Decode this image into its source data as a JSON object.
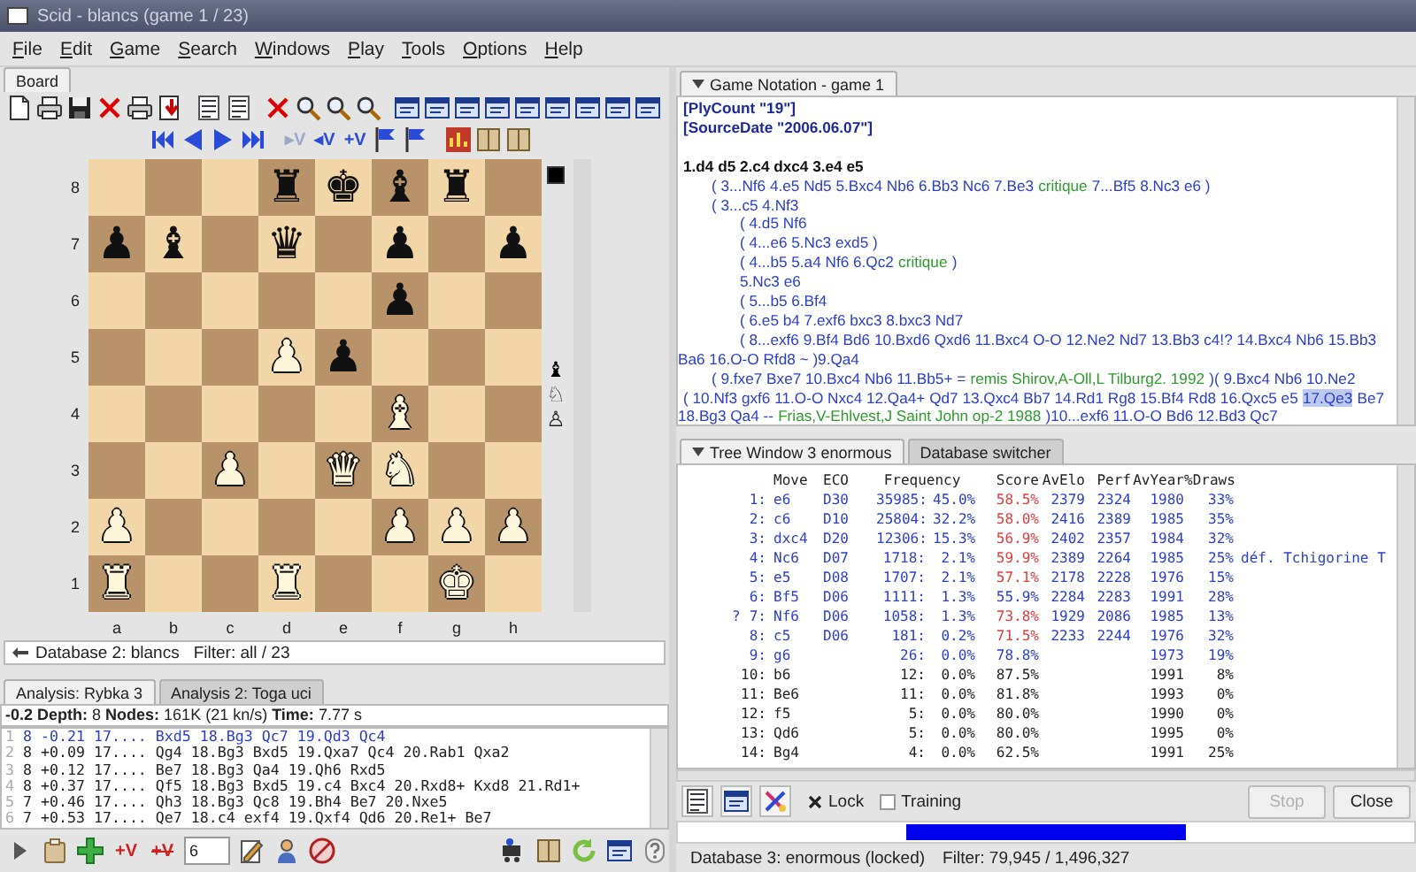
{
  "window": {
    "title": "Scid - blancs (game 1 / 23)"
  },
  "menu": [
    "File",
    "Edit",
    "Game",
    "Search",
    "Windows",
    "Play",
    "Tools",
    "Options",
    "Help"
  ],
  "board_panel": {
    "tab": "Board",
    "variation_buttons": [
      {
        "text": "▸V",
        "disabled": true
      },
      {
        "text": "◂V",
        "disabled": false
      },
      {
        "text": "+V",
        "disabled": false
      }
    ],
    "board": {
      "files": [
        "a",
        "b",
        "c",
        "d",
        "e",
        "f",
        "g",
        "h"
      ],
      "black_to_move": true,
      "material": [
        {
          "piece": "♝",
          "white": false
        },
        {
          "piece": "♘",
          "white": true
        },
        {
          "piece": "♙",
          "white": true
        }
      ],
      "ranks": [
        {
          "label": "8",
          "squares": [
            {
              "kind": "empty"
            },
            {
              "kind": "empty"
            },
            {
              "kind": "empty"
            },
            {
              "kind": "piece",
              "piece": "♜",
              "white": false
            },
            {
              "kind": "piece",
              "piece": "♚",
              "white": false
            },
            {
              "kind": "piece",
              "piece": "♝",
              "white": false
            },
            {
              "kind": "piece",
              "piece": "♜",
              "white": false
            },
            {
              "kind": "empty"
            }
          ]
        },
        {
          "label": "7",
          "squares": [
            {
              "kind": "piece",
              "piece": "♟",
              "white": false
            },
            {
              "kind": "piece",
              "piece": "♝",
              "white": false
            },
            {
              "kind": "empty"
            },
            {
              "kind": "piece",
              "piece": "♛",
              "white": false
            },
            {
              "kind": "empty"
            },
            {
              "kind": "piece",
              "piece": "♟",
              "white": false
            },
            {
              "kind": "empty"
            },
            {
              "kind": "piece",
              "piece": "♟",
              "white": false
            }
          ]
        },
        {
          "label": "6",
          "squares": [
            {
              "kind": "empty"
            },
            {
              "kind": "empty"
            },
            {
              "kind": "empty"
            },
            {
              "kind": "empty"
            },
            {
              "kind": "empty"
            },
            {
              "kind": "piece",
              "piece": "♟",
              "white": false
            },
            {
              "kind": "empty"
            },
            {
              "kind": "empty"
            }
          ]
        },
        {
          "label": "5",
          "squares": [
            {
              "kind": "empty"
            },
            {
              "kind": "empty"
            },
            {
              "kind": "empty"
            },
            {
              "kind": "piece",
              "piece": "♟",
              "white": true
            },
            {
              "kind": "piece",
              "piece": "♟",
              "white": false
            },
            {
              "kind": "empty"
            },
            {
              "kind": "empty"
            },
            {
              "kind": "empty"
            }
          ]
        },
        {
          "label": "4",
          "squares": [
            {
              "kind": "empty"
            },
            {
              "kind": "empty"
            },
            {
              "kind": "empty"
            },
            {
              "kind": "empty"
            },
            {
              "kind": "empty"
            },
            {
              "kind": "piece",
              "piece": "♝",
              "white": true
            },
            {
              "kind": "empty"
            },
            {
              "kind": "empty"
            }
          ]
        },
        {
          "label": "3",
          "squares": [
            {
              "kind": "empty"
            },
            {
              "kind": "empty"
            },
            {
              "kind": "piece",
              "piece": "♟",
              "white": true
            },
            {
              "kind": "empty"
            },
            {
              "kind": "piece",
              "piece": "♛",
              "white": true
            },
            {
              "kind": "piece",
              "piece": "♞",
              "white": true
            },
            {
              "kind": "empty"
            },
            {
              "kind": "empty"
            }
          ]
        },
        {
          "label": "2",
          "squares": [
            {
              "kind": "piece",
              "piece": "♟",
              "white": true
            },
            {
              "kind": "empty"
            },
            {
              "kind": "empty"
            },
            {
              "kind": "empty"
            },
            {
              "kind": "empty"
            },
            {
              "kind": "piece",
              "piece": "♟",
              "white": true
            },
            {
              "kind": "piece",
              "piece": "♟",
              "white": true
            },
            {
              "kind": "piece",
              "piece": "♟",
              "white": true
            }
          ]
        },
        {
          "label": "1",
          "squares": [
            {
              "kind": "piece",
              "piece": "♜",
              "white": true
            },
            {
              "kind": "empty"
            },
            {
              "kind": "empty"
            },
            {
              "kind": "piece",
              "piece": "♜",
              "white": true
            },
            {
              "kind": "empty"
            },
            {
              "kind": "empty"
            },
            {
              "kind": "piece",
              "piece": "♚",
              "white": true
            },
            {
              "kind": "empty"
            }
          ]
        }
      ]
    },
    "status": {
      "database": "Database 2: blancs",
      "filter": "Filter: all / 23"
    }
  },
  "analysis": {
    "tabs": [
      {
        "label": "Analysis: Rybka 3",
        "selected": true
      },
      {
        "label": "Analysis 2: Toga uci",
        "selected": false
      }
    ],
    "info": "**-0.2 Depth:** 8 **Nodes:** 161K (21 kn/s) **Time:** 7.77 s",
    "lines": [
      {
        "number": "1",
        "text": "8 -0.21 17.... Bxd5 18.Bg3 Qc7 19.Qd3 Qc4",
        "highlighted": true
      },
      {
        "number": "2",
        "text": "8 +0.09 17.... Qg4 18.Bg3 Bxd5 19.Qxa7 Qc4 20.Rab1 Qxa2",
        "highlighted": false
      },
      {
        "number": "3",
        "text": "8 +0.12 17.... Be7 18.Bg3 Qa4 19.Qh6 Rxd5",
        "highlighted": false
      },
      {
        "number": "4",
        "text": "8 +0.37 17.... Qf5 18.Bg3 Bxd5 19.c4 Bxc4 20.Rxd8+ Kxd8 21.Rd1+",
        "highlighted": false
      },
      {
        "number": "5",
        "text": "7 +0.46 17.... Qh3 18.Bg3 Qc8 19.Bh4 Be7 20.Nxe5",
        "highlighted": false
      },
      {
        "number": "6",
        "text": "7 +0.53 17.... Qe7 18.c4 exf4 19.Qxf4 Qd6 20.Re1+ Be7",
        "highlighted": false
      }
    ],
    "toolbar": {
      "add_variation": "+V",
      "add_all_variations": "+V",
      "line_count": "6"
    }
  },
  "notation": {
    "tab": "Game Notation - game 1",
    "headers": [
      "[PlyCount \"19\"]",
      "[SourceDate \"2006.06.07\"]"
    ],
    "lines": [
      {
        "segments": [
          {
            "kind": "main",
            "text": "1.d4 d5 2.c4 dxc4 3.e4 e5"
          }
        ],
        "children": [
          {
            "segments": [
              {
                "kind": "move",
                "text": "( 3...Nf6 4.e5 Nd5 5.Bxc4 Nb6 6.Bb3 Nc6 7.Be3"
              },
              {
                "kind": "comment",
                "text": "critique"
              },
              {
                "kind": "move",
                "text": "7...Bf5 8.Nc3 e6 )"
              }
            ]
          },
          {
            "segments": [
              {
                "kind": "move",
                "text": "( 3...c5 4.Nf3"
              }
            ],
            "children": [
              {
                "segments": [
                  {
                    "kind": "move",
                    "text": "( 4.d5 Nf6"
                  }
                ]
              },
              {
                "segments": [
                  {
                    "kind": "move",
                    "text": "( 4...e6 5.Nc3 exd5 )"
                  }
                ]
              },
              {
                "segments": [
                  {
                    "kind": "move",
                    "text": "( 4...b5 5.a4 Nf6 6.Qc2"
                  },
                  {
                    "kind": "comment",
                    "text": "critique"
                  },
                  {
                    "kind": "move",
                    "text": ")"
                  }
                ]
              },
              {
                "segments": [
                  {
                    "kind": "move",
                    "text": "5.Nc3 e6"
                  }
                ]
              },
              {
                "segments": [
                  {
                    "kind": "move",
                    "text": "( 5...b5 6.Bf4"
                  }
                ]
              },
              {
                "segments": [
                  {
                    "kind": "move",
                    "text": "( 6.e5 b4 7.exf6 bxc3 8.bxc3 Nd7"
                  }
                ]
              },
              {
                "segments": [
                  {
                    "kind": "move",
                    "text": "( 8...exf6 9.Bf4 Bd6 10.Bxd6 Qxd6 11.Bxc4 O-O 12.Ne2 Nd7 13.Bb3 c4!? 14.Bxc4 Nb6 15.Bb3 Ba6 16.O-O Rfd8 ~ )9.Qa4"
                  }
                ]
              }
            ]
          },
          {
            "segments": [
              {
                "kind": "move",
                "text": "( 9.fxe7 Bxe7 10.Bxc4 Nb6 11.Bb5+ ="
              },
              {
                "kind": "comment",
                "text": "remis Shirov,A-Oll,L Tilburg2. 1992"
              },
              {
                "kind": "move",
                "text": ")( 9.Bxc4 Nb6 10.Ne2"
              }
            ]
          }
        ]
      },
      {
        "segments": [
          {
            "kind": "move",
            "text": "( 10.Nf3 gxf6 11.O-O Nxc4 12.Qa4+ Qd7 13.Qxc4 Bb7 14.Rd1 Rg8 15.Bf4 Rd8 16.Qxc5 e5"
          },
          {
            "kind": "current",
            "text": "17.Qe3"
          },
          {
            "kind": "move",
            "text": "Be7 18.Bg3 Qa4 --"
          },
          {
            "kind": "comment",
            "text": "Frias,V-Ehlvest,J Saint John op-2 1988"
          },
          {
            "kind": "move",
            "text": ")10...exf6 11.O-O Bd6 12.Bd3 Qc7"
          }
        ]
      }
    ]
  },
  "tree": {
    "tabs": [
      {
        "label": "Tree Window 3 enormous",
        "selected": true
      },
      {
        "label": "Database switcher",
        "selected": false
      }
    ],
    "columns": [
      "Move",
      "ECO",
      "Frequency",
      "Score",
      "AvElo",
      "Perf",
      "AvYear",
      "%Draws"
    ],
    "rows": [
      {
        "number": "1:",
        "move": "e6",
        "eco": "D30",
        "count": "35985:",
        "percent": "45.0%",
        "score": "58.5%",
        "avelo": "2379",
        "perf": "2324",
        "avyear": "1980",
        "draws": "33%",
        "highlighted": true,
        "score_highlighted": true
      },
      {
        "number": "2:",
        "move": "c6",
        "eco": "D10",
        "count": "25804:",
        "percent": "32.2%",
        "score": "58.0%",
        "avelo": "2416",
        "perf": "2389",
        "avyear": "1985",
        "draws": "35%",
        "highlighted": true,
        "score_highlighted": true
      },
      {
        "number": "3:",
        "move": "dxc4",
        "eco": "D20",
        "count": "12306:",
        "percent": "15.3%",
        "score": "56.9%",
        "avelo": "2402",
        "perf": "2357",
        "avyear": "1984",
        "draws": "32%",
        "highlighted": true,
        "score_highlighted": true
      },
      {
        "number": "4:",
        "move": "Nc6",
        "eco": "D07",
        "count": "1718:",
        "percent": "2.1%",
        "score": "59.9%",
        "avelo": "2389",
        "perf": "2264",
        "avyear": "1985",
        "draws": "25%",
        "comment": "déf. Tchigorine T",
        "highlighted": true,
        "score_highlighted": true
      },
      {
        "number": "5:",
        "move": "e5",
        "eco": "D08",
        "count": "1707:",
        "percent": "2.1%",
        "score": "57.1%",
        "avelo": "2178",
        "perf": "2228",
        "avyear": "1976",
        "draws": "15%",
        "highlighted": true,
        "score_highlighted": true
      },
      {
        "number": "6:",
        "move": "Bf5",
        "eco": "D06",
        "count": "1111:",
        "percent": "1.3%",
        "score": "55.9%",
        "avelo": "2284",
        "perf": "2283",
        "avyear": "1991",
        "draws": "28%",
        "highlighted": true,
        "score_highlighted": false
      },
      {
        "marker": "?",
        "number": "7:",
        "move": "Nf6",
        "eco": "D06",
        "count": "1058:",
        "percent": "1.3%",
        "score": "73.8%",
        "avelo": "1929",
        "perf": "2086",
        "avyear": "1985",
        "draws": "13%",
        "highlighted": true,
        "score_highlighted": true
      },
      {
        "number": "8:",
        "move": "c5",
        "eco": "D06",
        "count": "181:",
        "percent": "0.2%",
        "score": "71.5%",
        "avelo": "2233",
        "perf": "2244",
        "avyear": "1976",
        "draws": "32%",
        "highlighted": true,
        "score_highlighted": true
      },
      {
        "number": "9:",
        "move": "g6",
        "count": "26:",
        "percent": "0.0%",
        "score": "78.8%",
        "avyear": "1973",
        "draws": "19%",
        "highlighted": true,
        "score_highlighted": false
      },
      {
        "number": "10:",
        "move": "b6",
        "count": "12:",
        "percent": "0.0%",
        "score": "87.5%",
        "avyear": "1991",
        "draws": "8%",
        "highlighted": false,
        "score_highlighted": false
      },
      {
        "number": "11:",
        "move": "Be6",
        "count": "11:",
        "percent": "0.0%",
        "score": "81.8%",
        "avyear": "1993",
        "draws": "0%",
        "highlighted": false,
        "score_highlighted": false
      },
      {
        "number": "12:",
        "move": "f5",
        "count": "5:",
        "percent": "0.0%",
        "score": "80.0%",
        "avyear": "1990",
        "draws": "0%",
        "highlighted": false,
        "score_highlighted": false
      },
      {
        "number": "13:",
        "move": "Qd6",
        "count": "5:",
        "percent": "0.0%",
        "score": "80.0%",
        "avyear": "1995",
        "draws": "0%",
        "highlighted": false,
        "score_highlighted": false
      },
      {
        "number": "14:",
        "move": "Bg4",
        "count": "4:",
        "percent": "0.0%",
        "score": "62.5%",
        "avyear": "1991",
        "draws": "25%",
        "highlighted": false,
        "score_highlighted": false
      }
    ],
    "lock": {
      "label": "Lock",
      "checked": true
    },
    "training": {
      "label": "Training",
      "checked": false
    },
    "buttons": [
      {
        "label": "Stop",
        "disabled": true
      },
      {
        "label": "Close",
        "disabled": false
      }
    ],
    "status": {
      "database": "Database 3: enormous (locked)",
      "filter": "Filter: 79,945 / 1,496,327"
    }
  }
}
